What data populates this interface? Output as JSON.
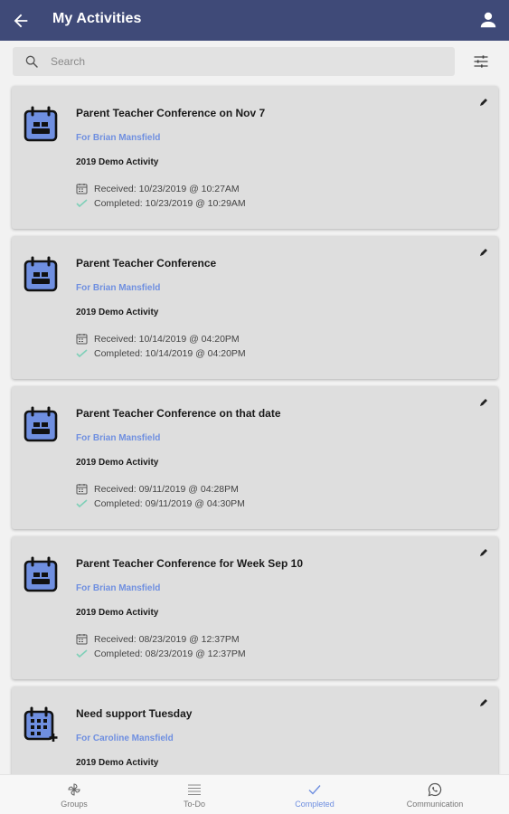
{
  "header": {
    "title": "My Activities",
    "back_icon": "arrow-left-icon",
    "user_icon": "person-icon"
  },
  "search": {
    "placeholder": "Search"
  },
  "activities": [
    {
      "title": "Parent Teacher Conference on Nov 7",
      "for": "For Brian Mansfield",
      "activity": "2019 Demo Activity",
      "received": "Received: 10/23/2019 @ 10:27AM",
      "completed": "Completed: 10/23/2019 @ 10:29AM",
      "icon": "calendar-people-icon"
    },
    {
      "title": "Parent Teacher Conference",
      "for": "For Brian Mansfield",
      "activity": "2019 Demo Activity",
      "received": "Received: 10/14/2019 @ 04:20PM",
      "completed": "Completed: 10/14/2019 @ 04:20PM",
      "icon": "calendar-people-icon"
    },
    {
      "title": "Parent Teacher Conference on that date",
      "for": "For Brian Mansfield",
      "activity": "2019 Demo Activity",
      "received": "Received: 09/11/2019 @ 04:28PM",
      "completed": "Completed: 09/11/2019 @ 04:30PM",
      "icon": "calendar-people-icon"
    },
    {
      "title": "Parent Teacher Conference for Week Sep 10",
      "for": "For Brian Mansfield",
      "activity": "2019 Demo Activity",
      "received": "Received: 08/23/2019 @ 12:37PM",
      "completed": "Completed: 08/23/2019 @ 12:37PM",
      "icon": "calendar-people-icon"
    },
    {
      "title": "Need support Tuesday",
      "for": "For Caroline Mansfield",
      "activity": "2019 Demo Activity",
      "received": "",
      "completed": "",
      "icon": "calendar-add-icon"
    }
  ],
  "bottom_nav": [
    {
      "label": "Groups",
      "icon": "pinwheel-icon",
      "active": false
    },
    {
      "label": "To-Do",
      "icon": "list-icon",
      "active": false
    },
    {
      "label": "Completed",
      "icon": "check-icon",
      "active": true
    },
    {
      "label": "Communication",
      "icon": "whatsapp-icon",
      "active": false
    }
  ],
  "colors": {
    "header": "#3f4a78",
    "accent": "#6f8fe0",
    "card": "#dedede",
    "completed_check": "#7fd0b8"
  }
}
